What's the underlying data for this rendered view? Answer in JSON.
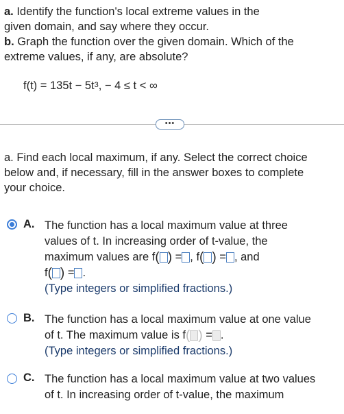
{
  "question": {
    "part_a_label": "a.",
    "part_a_text_l1": " Identify the function's local extreme values in the",
    "part_a_text_l2": "given domain, and say where they occur.",
    "part_b_label": "b.",
    "part_b_text_l1": " Graph the function over the given domain. Which of the",
    "part_b_text_l2": "extreme values, if any, are absolute?",
    "function_lhs": "f(t) = 135t − 5t",
    "function_exp": "3",
    "function_domain": ",  − 4 ≤ t < ∞"
  },
  "more_button": "•••",
  "subquestion": {
    "l1": "a. Find each local maximum, if any. Select the correct choice",
    "l2": "below and, if necessary, fill in the answer boxes to complete",
    "l3": "your choice."
  },
  "choices": [
    {
      "letter": "A.",
      "selected": true,
      "l1": "The function has a local maximum value at three",
      "l2": "values of t. In increasing order of t-value, the",
      "l3_pre": "maximum values are f",
      "eq": " =",
      "comma_f": ", f",
      "and": ", and",
      "f": "f",
      "period": ".",
      "hint": "(Type integers or simplified fractions.)"
    },
    {
      "letter": "B.",
      "selected": false,
      "l1": "The function has a local maximum value at one value",
      "l2_pre": "of t. The maximum value is f",
      "eq": " =",
      "period": ".",
      "hint": "(Type integers or simplified fractions.)"
    },
    {
      "letter": "C.",
      "selected": false,
      "l1": "The function has a local maximum value at two values",
      "l2": "of t. In increasing order of t-value, the maximum"
    }
  ],
  "colors": {
    "accent": "#3b7dd8",
    "text": "#222222",
    "hint": "#1a3a6b"
  }
}
